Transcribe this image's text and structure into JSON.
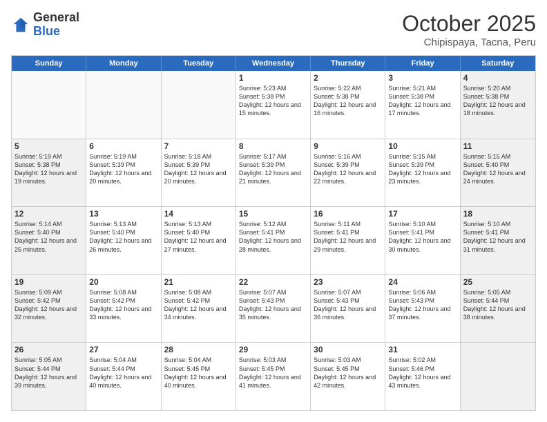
{
  "header": {
    "logo_general": "General",
    "logo_blue": "Blue",
    "month_title": "October 2025",
    "subtitle": "Chipispaya, Tacna, Peru"
  },
  "weekdays": [
    "Sunday",
    "Monday",
    "Tuesday",
    "Wednesday",
    "Thursday",
    "Friday",
    "Saturday"
  ],
  "rows": [
    [
      {
        "day": "",
        "info": "",
        "shaded": false,
        "empty": true
      },
      {
        "day": "",
        "info": "",
        "shaded": false,
        "empty": true
      },
      {
        "day": "",
        "info": "",
        "shaded": false,
        "empty": true
      },
      {
        "day": "1",
        "info": "Sunrise: 5:23 AM\nSunset: 5:38 PM\nDaylight: 12 hours and 15 minutes.",
        "shaded": false,
        "empty": false
      },
      {
        "day": "2",
        "info": "Sunrise: 5:22 AM\nSunset: 5:38 PM\nDaylight: 12 hours and 16 minutes.",
        "shaded": false,
        "empty": false
      },
      {
        "day": "3",
        "info": "Sunrise: 5:21 AM\nSunset: 5:38 PM\nDaylight: 12 hours and 17 minutes.",
        "shaded": false,
        "empty": false
      },
      {
        "day": "4",
        "info": "Sunrise: 5:20 AM\nSunset: 5:38 PM\nDaylight: 12 hours and 18 minutes.",
        "shaded": true,
        "empty": false
      }
    ],
    [
      {
        "day": "5",
        "info": "Sunrise: 5:19 AM\nSunset: 5:38 PM\nDaylight: 12 hours and 19 minutes.",
        "shaded": true,
        "empty": false
      },
      {
        "day": "6",
        "info": "Sunrise: 5:19 AM\nSunset: 5:39 PM\nDaylight: 12 hours and 20 minutes.",
        "shaded": false,
        "empty": false
      },
      {
        "day": "7",
        "info": "Sunrise: 5:18 AM\nSunset: 5:39 PM\nDaylight: 12 hours and 20 minutes.",
        "shaded": false,
        "empty": false
      },
      {
        "day": "8",
        "info": "Sunrise: 5:17 AM\nSunset: 5:39 PM\nDaylight: 12 hours and 21 minutes.",
        "shaded": false,
        "empty": false
      },
      {
        "day": "9",
        "info": "Sunrise: 5:16 AM\nSunset: 5:39 PM\nDaylight: 12 hours and 22 minutes.",
        "shaded": false,
        "empty": false
      },
      {
        "day": "10",
        "info": "Sunrise: 5:15 AM\nSunset: 5:39 PM\nDaylight: 12 hours and 23 minutes.",
        "shaded": false,
        "empty": false
      },
      {
        "day": "11",
        "info": "Sunrise: 5:15 AM\nSunset: 5:40 PM\nDaylight: 12 hours and 24 minutes.",
        "shaded": true,
        "empty": false
      }
    ],
    [
      {
        "day": "12",
        "info": "Sunrise: 5:14 AM\nSunset: 5:40 PM\nDaylight: 12 hours and 25 minutes.",
        "shaded": true,
        "empty": false
      },
      {
        "day": "13",
        "info": "Sunrise: 5:13 AM\nSunset: 5:40 PM\nDaylight: 12 hours and 26 minutes.",
        "shaded": false,
        "empty": false
      },
      {
        "day": "14",
        "info": "Sunrise: 5:13 AM\nSunset: 5:40 PM\nDaylight: 12 hours and 27 minutes.",
        "shaded": false,
        "empty": false
      },
      {
        "day": "15",
        "info": "Sunrise: 5:12 AM\nSunset: 5:41 PM\nDaylight: 12 hours and 28 minutes.",
        "shaded": false,
        "empty": false
      },
      {
        "day": "16",
        "info": "Sunrise: 5:11 AM\nSunset: 5:41 PM\nDaylight: 12 hours and 29 minutes.",
        "shaded": false,
        "empty": false
      },
      {
        "day": "17",
        "info": "Sunrise: 5:10 AM\nSunset: 5:41 PM\nDaylight: 12 hours and 30 minutes.",
        "shaded": false,
        "empty": false
      },
      {
        "day": "18",
        "info": "Sunrise: 5:10 AM\nSunset: 5:41 PM\nDaylight: 12 hours and 31 minutes.",
        "shaded": true,
        "empty": false
      }
    ],
    [
      {
        "day": "19",
        "info": "Sunrise: 5:09 AM\nSunset: 5:42 PM\nDaylight: 12 hours and 32 minutes.",
        "shaded": true,
        "empty": false
      },
      {
        "day": "20",
        "info": "Sunrise: 5:08 AM\nSunset: 5:42 PM\nDaylight: 12 hours and 33 minutes.",
        "shaded": false,
        "empty": false
      },
      {
        "day": "21",
        "info": "Sunrise: 5:08 AM\nSunset: 5:42 PM\nDaylight: 12 hours and 34 minutes.",
        "shaded": false,
        "empty": false
      },
      {
        "day": "22",
        "info": "Sunrise: 5:07 AM\nSunset: 5:43 PM\nDaylight: 12 hours and 35 minutes.",
        "shaded": false,
        "empty": false
      },
      {
        "day": "23",
        "info": "Sunrise: 5:07 AM\nSunset: 5:43 PM\nDaylight: 12 hours and 36 minutes.",
        "shaded": false,
        "empty": false
      },
      {
        "day": "24",
        "info": "Sunrise: 5:06 AM\nSunset: 5:43 PM\nDaylight: 12 hours and 37 minutes.",
        "shaded": false,
        "empty": false
      },
      {
        "day": "25",
        "info": "Sunrise: 5:05 AM\nSunset: 5:44 PM\nDaylight: 12 hours and 38 minutes.",
        "shaded": true,
        "empty": false
      }
    ],
    [
      {
        "day": "26",
        "info": "Sunrise: 5:05 AM\nSunset: 5:44 PM\nDaylight: 12 hours and 39 minutes.",
        "shaded": true,
        "empty": false
      },
      {
        "day": "27",
        "info": "Sunrise: 5:04 AM\nSunset: 5:44 PM\nDaylight: 12 hours and 40 minutes.",
        "shaded": false,
        "empty": false
      },
      {
        "day": "28",
        "info": "Sunrise: 5:04 AM\nSunset: 5:45 PM\nDaylight: 12 hours and 40 minutes.",
        "shaded": false,
        "empty": false
      },
      {
        "day": "29",
        "info": "Sunrise: 5:03 AM\nSunset: 5:45 PM\nDaylight: 12 hours and 41 minutes.",
        "shaded": false,
        "empty": false
      },
      {
        "day": "30",
        "info": "Sunrise: 5:03 AM\nSunset: 5:45 PM\nDaylight: 12 hours and 42 minutes.",
        "shaded": false,
        "empty": false
      },
      {
        "day": "31",
        "info": "Sunrise: 5:02 AM\nSunset: 5:46 PM\nDaylight: 12 hours and 43 minutes.",
        "shaded": false,
        "empty": false
      },
      {
        "day": "",
        "info": "",
        "shaded": true,
        "empty": true
      }
    ]
  ]
}
